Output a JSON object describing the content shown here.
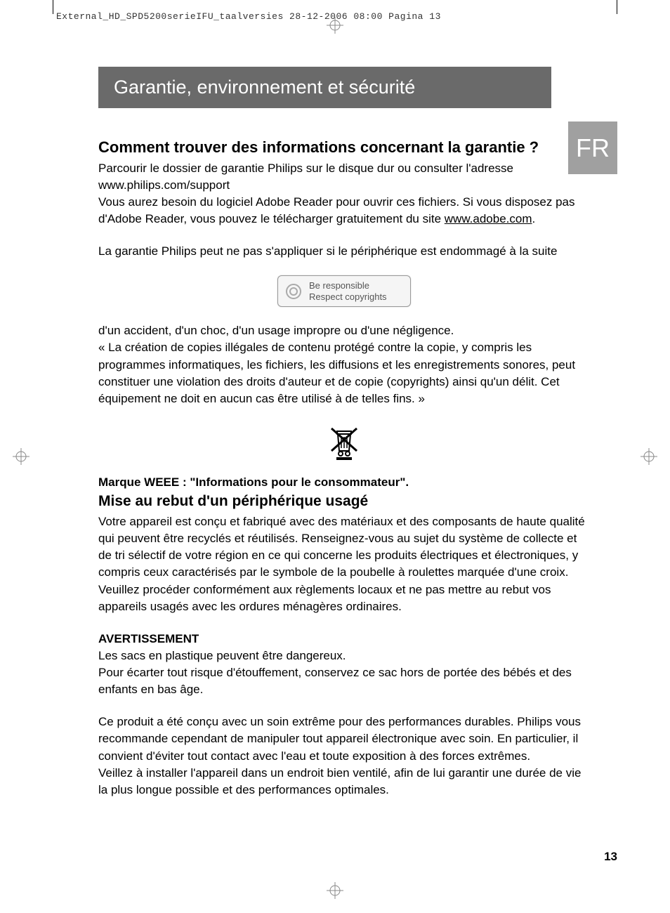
{
  "header": {
    "print_info": "External_HD_SPD5200serieIFU_taalversies  28-12-2006  08:00  Pagina 13"
  },
  "title_bar": "Garantie, environnement et sécurité",
  "lang_tab": "FR",
  "section1": {
    "heading": "Comment trouver des informations concernant la garantie ?",
    "p1": "Parcourir le dossier de garantie Philips sur le disque dur ou consulter l'adresse www.philips.com/support",
    "p2a": "Vous aurez besoin du logiciel Adobe Reader pour ouvrir ces fichiers. Si vous  disposez pas d'Adobe Reader, vous pouvez le télécharger gratuitement du site ",
    "p2_link": "www.adobe.com",
    "p2b": ".",
    "p3": "La garantie Philips peut ne pas s'appliquer si le périphérique est endommagé à la suite"
  },
  "copyright_box": {
    "line1": "Be responsible",
    "line2": "Respect copyrights"
  },
  "section2": {
    "p1": "d'un accident, d'un choc, d'un usage impropre ou d'une négligence.",
    "p2": "« La création de copies illégales de contenu protégé contre la copie, y compris les programmes informatiques, les fichiers, les diffusions et les enregistrements sonores, peut constituer une violation des droits d'auteur et de copie (copyrights) ainsi qu'un délit. Cet équipement ne doit en aucun cas être utilisé à de telles fins. »"
  },
  "weee": {
    "label": "Marque WEEE : \"Informations pour le consommateur\".",
    "heading": "Mise au rebut d'un périphérique usagé",
    "p1": "Votre appareil est conçu et fabriqué avec des matériaux et des composants de haute qualité qui peuvent être recyclés et réutilisés. Renseignez-vous au sujet du système de collecte et de tri sélectif de votre région en ce qui concerne les produits électriques et électroniques, y compris ceux caractérisés par le symbole de la poubelle à roulettes marquée d'une croix.",
    "p2": "Veuillez procéder conformément aux règlements locaux et ne pas mettre au rebut vos appareils usagés avec les ordures ménagères ordinaires."
  },
  "warning": {
    "heading": "AVERTISSEMENT",
    "p1": "Les sacs en plastique peuvent être dangereux.",
    "p2": "Pour écarter tout risque d'étouffement, conservez ce sac hors de portée des bébés et des enfants en bas âge.",
    "p3": "Ce produit a été conçu avec un soin extrême pour des performances durables. Philips vous recommande cependant de manipuler tout appareil électronique avec soin. En particulier, il convient d'éviter tout contact avec l'eau et toute exposition à des forces extrêmes.",
    "p4": "Veillez à installer l'appareil dans un endroit bien ventilé, afin de lui garantir une durée de vie la plus longue possible et des performances optimales."
  },
  "page_number": "13"
}
